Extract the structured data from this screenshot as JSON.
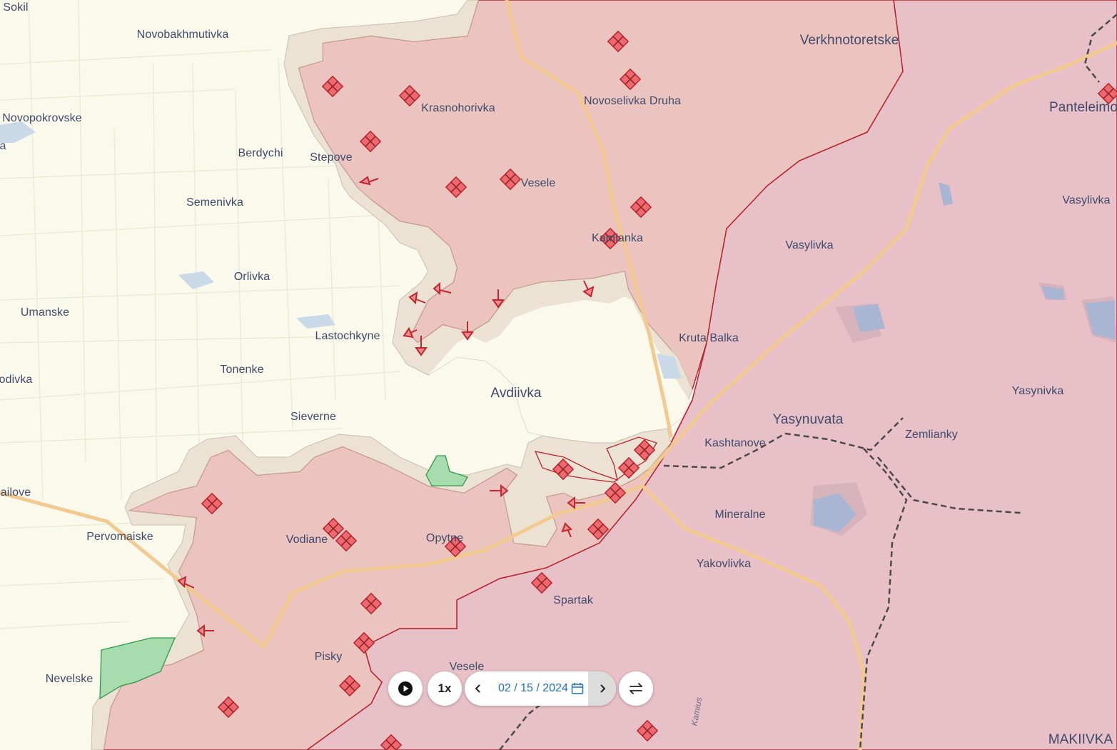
{
  "map": {
    "colors": {
      "background": "#fbf8ec",
      "occupied": "#e9c2bf",
      "advance": "#f0b9b3",
      "contested": "#ece3d6",
      "liberated": "#9fd6a4",
      "frontline": "#b8232c",
      "marker": "#e8434f"
    },
    "places": [
      {
        "name": "Sokil"
      },
      {
        "name": "Novobakhmutivka"
      },
      {
        "name": "Novopokrovske"
      },
      {
        "name": "Berdychi"
      },
      {
        "name": "Stepove"
      },
      {
        "name": "Semenivka"
      },
      {
        "name": "Orlivka"
      },
      {
        "name": "Umanske"
      },
      {
        "name": "Lastochkyne"
      },
      {
        "name": "Tonenke"
      },
      {
        "name": "odivka"
      },
      {
        "name": "Sieverne"
      },
      {
        "name": "Avdiivka"
      },
      {
        "name": "ailove"
      },
      {
        "name": "Pervomaiske"
      },
      {
        "name": "Vodiane"
      },
      {
        "name": "Opytne"
      },
      {
        "name": "Nevelske"
      },
      {
        "name": "Pisky"
      },
      {
        "name": "Vesele"
      },
      {
        "name": "Spartak"
      },
      {
        "name": "Krasnohorivka"
      },
      {
        "name": "Vesele"
      },
      {
        "name": "Kamianka"
      },
      {
        "name": "Novoselivka Druha"
      },
      {
        "name": "Verkhnotoretske"
      },
      {
        "name": "Vasylivka"
      },
      {
        "name": "Kruta Balka"
      },
      {
        "name": "Yasynuvata"
      },
      {
        "name": "Kashtanove"
      },
      {
        "name": "Zemlianky"
      },
      {
        "name": "Mineralne"
      },
      {
        "name": "Yakovlivka"
      },
      {
        "name": "Yasynivka"
      },
      {
        "name": "Vasylivka"
      },
      {
        "name": "Panteleimo"
      },
      {
        "name": "MAKIIVKA"
      },
      {
        "name": "a"
      }
    ],
    "river_label": "Kamius"
  },
  "controls": {
    "play_icon": "play-icon",
    "speed_label": "1x",
    "date_value": "02 / 15 / 2024",
    "prev_icon": "chevron-left-icon",
    "next_icon": "chevron-right-icon",
    "calendar_icon": "calendar-icon",
    "compare_icon": "swap-icon"
  }
}
